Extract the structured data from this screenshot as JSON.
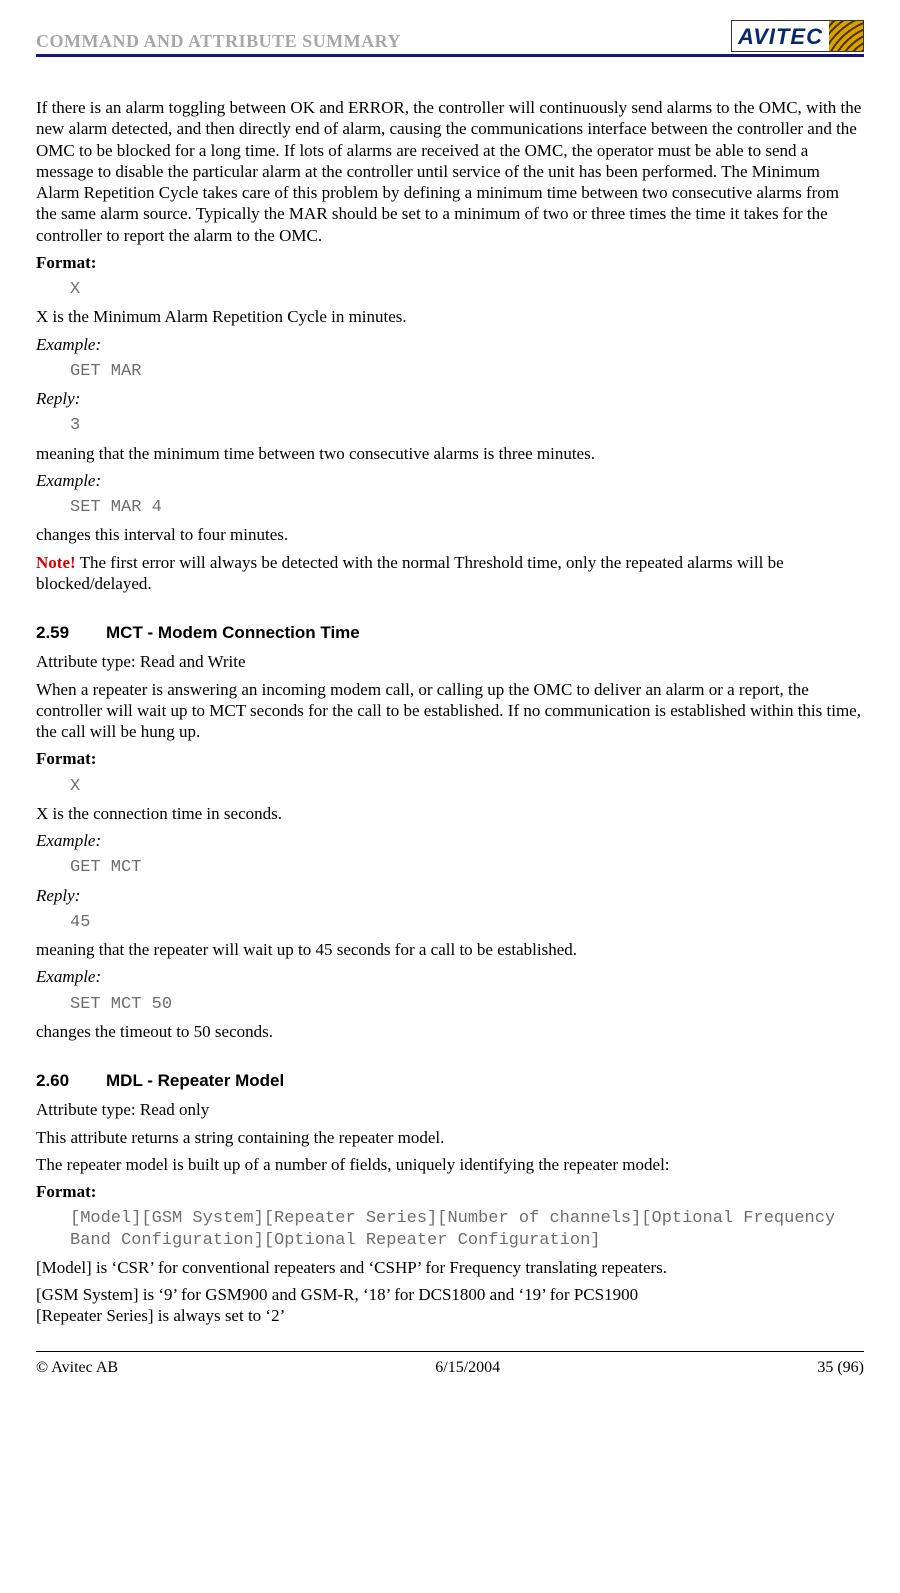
{
  "header": {
    "title": "COMMAND AND ATTRIBUTE SUMMARY",
    "logo_text": "AVITEC"
  },
  "body": {
    "intro": "If there is an alarm toggling between OK and ERROR, the controller will continuously send alarms to the OMC, with the new alarm detected, and then directly end of alarm, causing the communications interface between the controller and the OMC to be blocked for a long time. If lots of alarms are received at the OMC, the operator must be able to send a message to disable the particular alarm at the controller until service of the unit has been performed. The Minimum Alarm Repetition Cycle takes care of this problem by defining a minimum time between two consecutive alarms from the same alarm source. Typically the MAR should be set to a minimum of two or three times the time it takes for the controller to report the alarm to the OMC.",
    "mar": {
      "format_label": "Format:",
      "format_val": "X",
      "format_expl": "X is the Minimum Alarm Repetition Cycle in minutes.",
      "ex1_label": "Example:",
      "ex1_cmd": "GET MAR",
      "reply_label": "Reply:",
      "reply_val": "3",
      "reply_expl": "meaning that the minimum time between two consecutive alarms is three minutes.",
      "ex2_label": "Example:",
      "ex2_cmd": "SET MAR 4",
      "ex2_expl": "changes this interval to four minutes.",
      "note_label": "Note!",
      "note_text": " The first error will always be detected with the normal Threshold time, only the repeated alarms will be blocked/delayed."
    },
    "s259": {
      "num": "2.59",
      "title": "MCT - Modem Connection Time",
      "attr_type": "Attribute type: Read and Write",
      "desc": "When a repeater is answering an incoming modem call, or calling up the OMC to deliver an alarm or a report, the controller will wait up to MCT seconds for the call to be established. If no communication is established within this time, the call will be hung up.",
      "format_label": "Format:",
      "format_val": "X",
      "format_expl": "X is the connection time in seconds.",
      "ex1_label": "Example:",
      "ex1_cmd": "GET MCT",
      "reply_label": "Reply:",
      "reply_val": "45",
      "reply_expl": "meaning that the repeater will wait up to 45 seconds for a call to be established.",
      "ex2_label": "Example:",
      "ex2_cmd": "SET MCT 50",
      "ex2_expl": "changes the timeout to 50 seconds."
    },
    "s260": {
      "num": "2.60",
      "title": "MDL - Repeater Model",
      "attr_type": "Attribute type: Read only",
      "desc1": "This attribute returns a string containing the repeater model.",
      "desc2": "The repeater model is built up of a number of fields, uniquely identifying the repeater model:",
      "format_label": "Format:",
      "format_val": "[Model][GSM System][Repeater Series][Number of channels][Optional Frequency Band Configuration][Optional Repeater Configuration]",
      "model_expl": "[Model] is ‘CSR’ for conventional repeaters and ‘CSHP’ for Frequency translating repeaters.",
      "gsm_expl": "[GSM System] is ‘9’ for GSM900 and GSM-R, ‘18’ for DCS1800 and ‘19’ for PCS1900",
      "series_expl": "[Repeater Series] is always set to ‘2’"
    }
  },
  "footer": {
    "left": "© Avitec AB",
    "center": "6/15/2004",
    "right": "35 (96)"
  }
}
